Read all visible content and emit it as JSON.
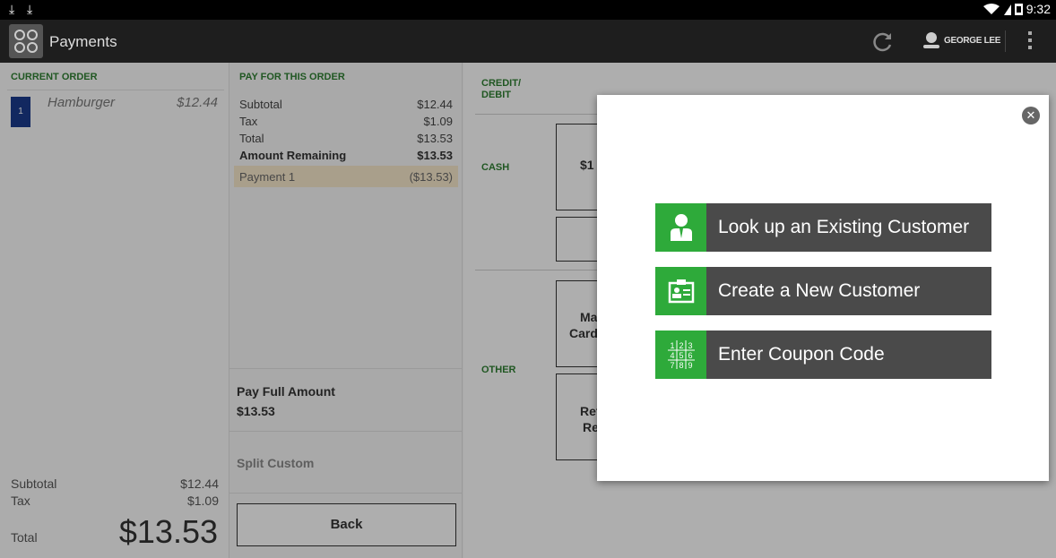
{
  "statusbar": {
    "time": "9:32"
  },
  "appbar": {
    "title": "Payments",
    "user_name": "GEORGE LEE"
  },
  "current_order": {
    "title": "CURRENT ORDER",
    "items": [
      {
        "qty": "1",
        "name": "Hamburger",
        "price": "$12.44"
      }
    ],
    "subtotal_label": "Subtotal",
    "subtotal_value": "$12.44",
    "tax_label": "Tax",
    "tax_value": "$1.09",
    "total_label": "Total",
    "total_value": "$13.53"
  },
  "pay_order": {
    "title": "PAY FOR THIS ORDER",
    "rows": [
      {
        "label": "Subtotal",
        "value": "$12.44"
      },
      {
        "label": "Tax",
        "value": "$1.09"
      },
      {
        "label": "Total",
        "value": "$13.53"
      },
      {
        "label": "Amount Remaining",
        "value": "$13.53"
      }
    ],
    "payment": {
      "label": "Payment 1",
      "value": "($13.53)"
    },
    "pay_full_title": "Pay Full Amount",
    "pay_full_amount": "$13.53",
    "split_label": "Split Custom",
    "back_label": "Back"
  },
  "methods": {
    "credit_label_1": "CREDIT/",
    "credit_label_2": "DEBIT",
    "cash_label": "CASH",
    "cash_tile_1": "$1",
    "other_label": "OTHER",
    "other_tile_1_line1": "Ma",
    "other_tile_1_line2": "Card",
    "other_tile_2_line1": "Ref",
    "other_tile_2_line2": "Re"
  },
  "modal": {
    "options": [
      {
        "label": "Look up an Existing Customer",
        "icon": "customer-icon"
      },
      {
        "label": "Create a New Customer",
        "icon": "id-card-icon"
      },
      {
        "label": "Enter Coupon Code",
        "icon": "keypad-icon"
      }
    ],
    "colors": {
      "icon_bg": "#2eaa3a",
      "button_bg": "#4a4a4a"
    }
  }
}
